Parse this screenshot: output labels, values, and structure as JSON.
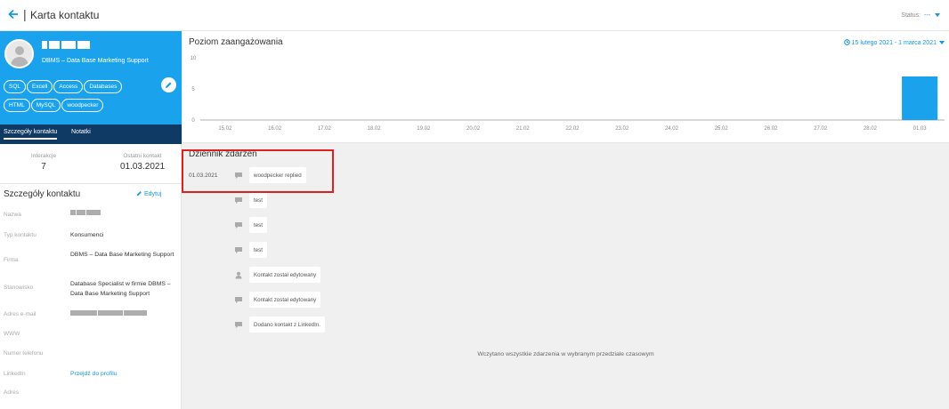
{
  "header": {
    "title": "Karta kontaktu",
    "status_label": "Status:",
    "status_value": "---"
  },
  "profile": {
    "company": "DBMS – Data Base Marketing Support",
    "tags": [
      "SQL",
      "Excell",
      "Access",
      "Databases",
      "HTML",
      "MySQL",
      "woodpecker"
    ]
  },
  "profile_tabs": [
    {
      "label": "Szczegóły kontaktu",
      "active": true
    },
    {
      "label": "Notatki",
      "active": false
    }
  ],
  "stats": {
    "interactions_label": "Interakcje",
    "interactions_value": "7",
    "last_contact_label": "Ostatni kontakt",
    "last_contact_value": "01.03.2021"
  },
  "details": {
    "heading": "Szczegóły kontaktu",
    "edit_label": "Edytuj",
    "rows": [
      {
        "key": "Nazwa",
        "value": ""
      },
      {
        "key": "Typ kontaktu",
        "value": "Konsumenci"
      },
      {
        "key": "Firma",
        "value": "DBMS – Data Base Marketing Support"
      },
      {
        "key": "Stanowisko",
        "value": "Database Specialist w firmie DBMS – Data Base Marketing Support"
      },
      {
        "key": "Adres e-mail",
        "value": ""
      },
      {
        "key": "WWW",
        "value": ""
      },
      {
        "key": "Numer telefonu",
        "value": ""
      },
      {
        "key": "LinkedIn",
        "value": "Przejdź do profilu"
      },
      {
        "key": "Adres",
        "value": ""
      }
    ]
  },
  "chart_panel": {
    "title": "Poziom zaangażowania",
    "date_range": "15 lutego 2021 - 1 marca 2021"
  },
  "chart_data": {
    "type": "bar",
    "title": "Poziom zaangażowania",
    "categories": [
      "15.02",
      "16.02",
      "17.02",
      "18.02",
      "19.02",
      "20.02",
      "21.02",
      "22.02",
      "23.02",
      "24.02",
      "25.02",
      "26.02",
      "27.02",
      "28.02",
      "01.03"
    ],
    "values": [
      0,
      0,
      0,
      0,
      0,
      0,
      0,
      0,
      0,
      0,
      0,
      0,
      0,
      0,
      7
    ],
    "yticks": [
      "0",
      "5",
      "10"
    ],
    "ylim": [
      0,
      10
    ],
    "bar_color": "#1aa3ec",
    "grid": false
  },
  "event_log": {
    "title": "Dziennik zdarzeń",
    "events": [
      {
        "date": "01.03.2021",
        "icon": "comment-icon",
        "text": "woodpecker replied"
      },
      {
        "date": "",
        "icon": "comment-icon",
        "text": "test"
      },
      {
        "date": "",
        "icon": "comment-icon",
        "text": "test"
      },
      {
        "date": "",
        "icon": "comment-icon",
        "text": "test"
      },
      {
        "date": "",
        "icon": "user-icon",
        "text": "Kontakt został edytowany"
      },
      {
        "date": "",
        "icon": "comment-icon",
        "text": "Kontakt został edytowany"
      },
      {
        "date": "",
        "icon": "comment-icon",
        "text": "Dodano kontakt z LinkedIn."
      }
    ],
    "loaded_message": "Wczytano wszystkie zdarzenia w wybranym przedziale czasowym"
  },
  "colors": {
    "accent": "#1597e5",
    "profile_bg": "#1aa3ec",
    "tabs_bg": "#0f3a63",
    "highlight": "#e01f1f"
  }
}
